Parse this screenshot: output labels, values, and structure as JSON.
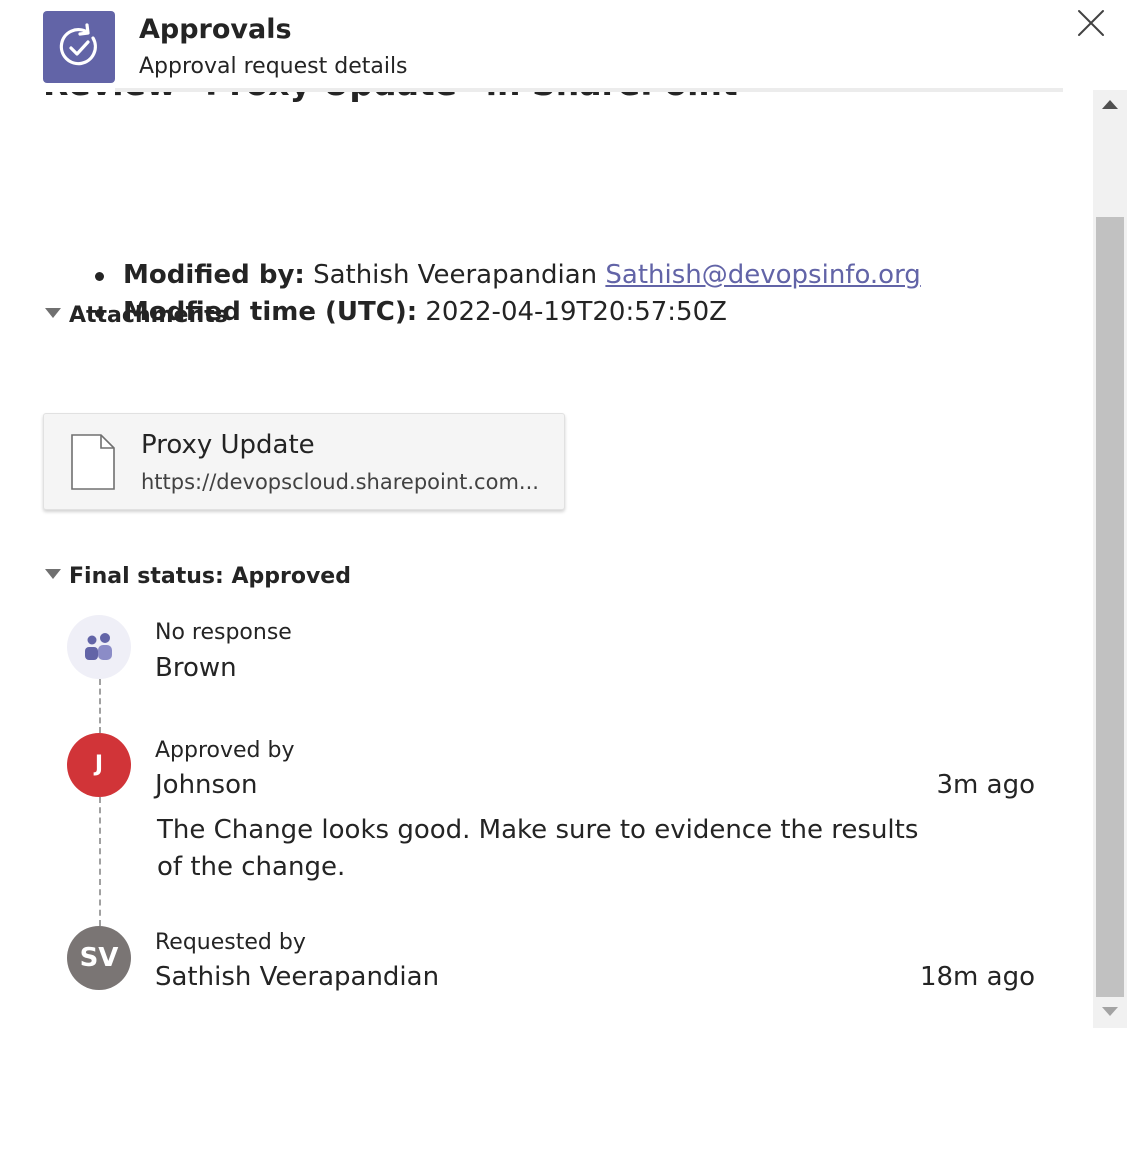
{
  "header": {
    "app_title": "Approvals",
    "app_subtitle": "Approval request details",
    "app_icon": "approvals-icon",
    "accent_color": "#6264a7"
  },
  "request": {
    "title": "Review \"Proxy Update\" in SharePoint",
    "details": [
      {
        "label": "Modified by:",
        "value": "Sathish Veerapandian",
        "link": "Sathish@devopsinfo.org"
      },
      {
        "label": "Modfied time (UTC):",
        "value": "2022-04-19T20:57:50Z"
      }
    ]
  },
  "attachments": {
    "heading": "Attachments",
    "items": [
      {
        "name": "Proxy Update",
        "url": "https://devopscloud.sharepoint.com..."
      }
    ]
  },
  "status": {
    "heading": "Final status: Approved",
    "entries": [
      {
        "label": "No response",
        "name": "Brown",
        "time": "",
        "avatar": "team-icon"
      },
      {
        "label": "Approved by",
        "name": "Johnson",
        "time": "3m ago",
        "initials": "J",
        "avatar_color": "#d13438",
        "comment": "The Change looks good. Make sure to evidence the results of the change."
      },
      {
        "label": "Requested by",
        "name": "Sathish Veerapandian",
        "time": "18m ago",
        "initials": "SV",
        "avatar_color": "#7a7574"
      }
    ]
  }
}
